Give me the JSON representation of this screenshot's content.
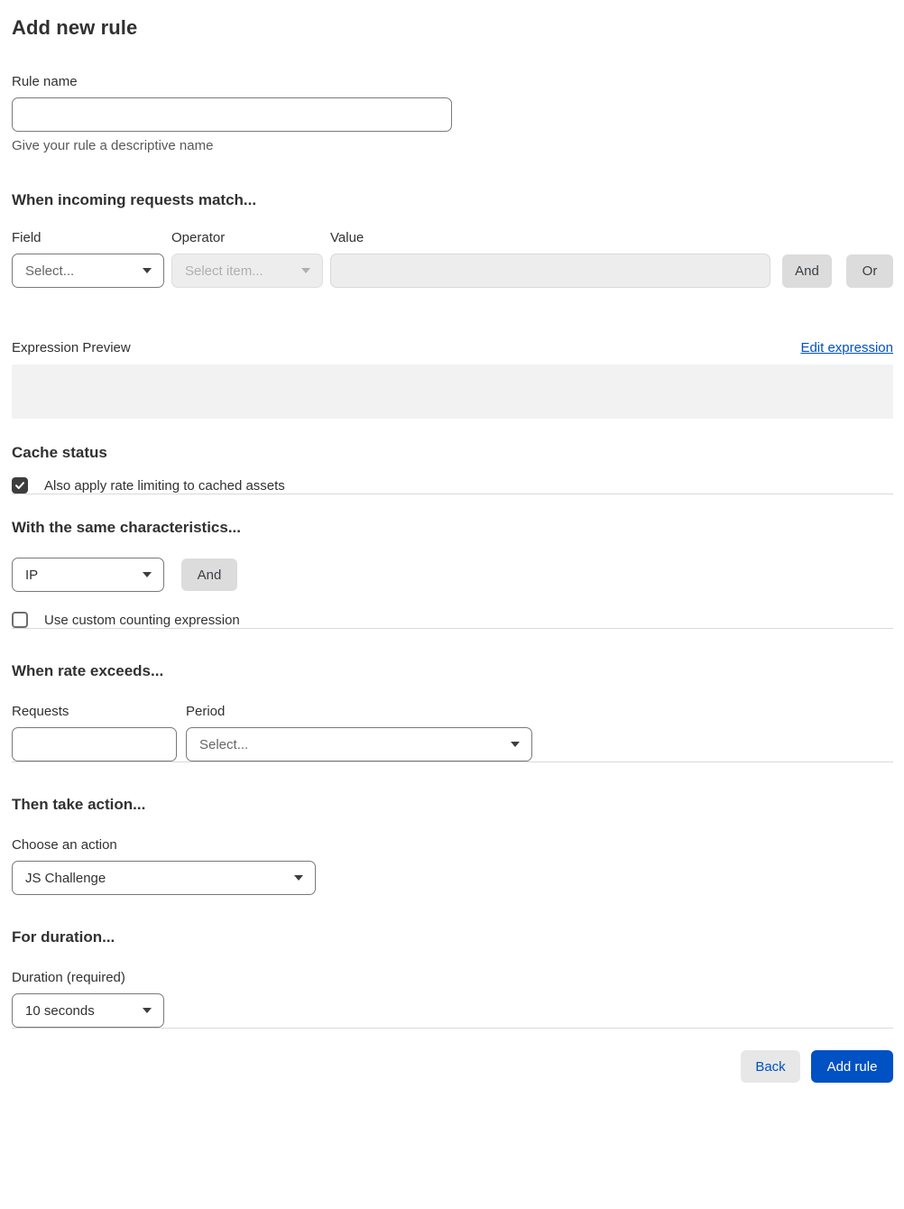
{
  "page": {
    "title": "Add new rule"
  },
  "rule_name": {
    "label": "Rule name",
    "value": "",
    "help": "Give your rule a descriptive name"
  },
  "match": {
    "heading": "When incoming requests match...",
    "field": {
      "label": "Field",
      "selected": "Select..."
    },
    "operator": {
      "label": "Operator",
      "selected": "Select item...",
      "disabled": true
    },
    "value": {
      "label": "Value",
      "value": "",
      "disabled": true
    },
    "and_label": "And",
    "or_label": "Or",
    "expression_preview_label": "Expression Preview",
    "edit_expression_label": "Edit expression",
    "expression_value": ""
  },
  "cache": {
    "heading": "Cache status",
    "checkbox_label": "Also apply rate limiting to cached assets",
    "checked": true
  },
  "characteristics": {
    "heading": "With the same characteristics...",
    "selected": "IP",
    "and_label": "And",
    "checkbox_label": "Use custom counting expression",
    "checked": false
  },
  "rate": {
    "heading": "When rate exceeds...",
    "requests_label": "Requests",
    "requests_value": "",
    "period_label": "Period",
    "period_selected": "Select..."
  },
  "action": {
    "heading": "Then take action...",
    "label": "Choose an action",
    "selected": "JS Challenge"
  },
  "duration": {
    "heading": "For duration...",
    "label": "Duration (required)",
    "selected": "10 seconds"
  },
  "footer": {
    "back_label": "Back",
    "submit_label": "Add rule"
  },
  "colors": {
    "accent_blue": "#0051c3",
    "link_blue": "#0051c3",
    "checkbox_checked": "#3d3d3d",
    "disabled_bg": "#ededed",
    "preview_bg": "#f2f2f2",
    "divider": "#d9d9d9"
  }
}
